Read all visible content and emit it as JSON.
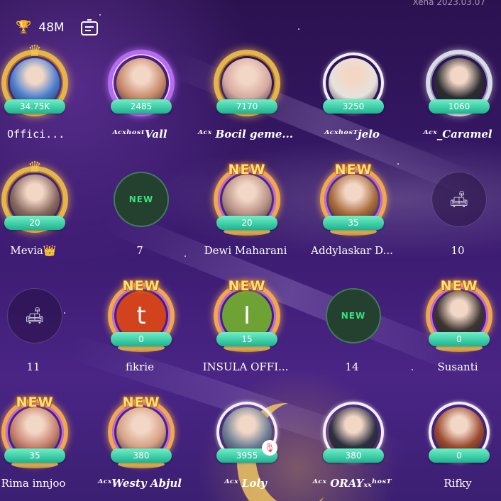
{
  "header": {
    "watermark": "Xena 2023.03.07",
    "trophy_icon": "trophy-icon",
    "trophy_value": "48M",
    "board_icon": "notice-board-icon"
  },
  "seats": [
    {
      "id": 1,
      "name": "Offici...",
      "score": "34.75K",
      "avatar": "#4a7fd0",
      "frame": "gold-crown"
    },
    {
      "id": 2,
      "name": "ᴬᶜˣʰᵒˢᵗVall",
      "score": "2485",
      "avatar": "#c78a6a",
      "frame": "purple"
    },
    {
      "id": 3,
      "name": "ᴬᶜˣ Bocil geme...",
      "score": "7170",
      "avatar": "#d7a9a0",
      "frame": "gold"
    },
    {
      "id": 4,
      "name": "ᴬᶜˣʰᵒˢᵀjelo",
      "score": "3250",
      "avatar": "#e6e2dd",
      "frame": "white"
    },
    {
      "id": 5,
      "name": "ᴬᶜˣ_Caramel",
      "score": "1060",
      "avatar": "#2c2c30",
      "frame": "silver"
    },
    {
      "id": 6,
      "name": "Mevia👑",
      "score": "20",
      "avatar": "#8a6a60",
      "frame": "gold-crown"
    },
    {
      "id": 7,
      "name": "7",
      "score": "",
      "badge": "NEW",
      "frame": "new-empty"
    },
    {
      "id": 8,
      "name": "Dewi Maharani",
      "score": "20",
      "avatar": "#b89186",
      "frame": "new"
    },
    {
      "id": 9,
      "name": "Addylaskar D...",
      "score": "35",
      "avatar": "#a86b3c",
      "frame": "new"
    },
    {
      "id": 10,
      "name": "10",
      "score": "",
      "frame": "empty"
    },
    {
      "id": 11,
      "name": "11",
      "score": "",
      "frame": "empty"
    },
    {
      "id": 12,
      "name": "fikrie",
      "score": "0",
      "letter": "t",
      "avatar": "#d2421c",
      "frame": "new"
    },
    {
      "id": 13,
      "name": "INSULA OFFI...",
      "score": "15",
      "letter": "I",
      "avatar": "#6ea234",
      "frame": "new"
    },
    {
      "id": 14,
      "name": "14",
      "score": "",
      "badge": "NEW",
      "frame": "new-empty"
    },
    {
      "id": 15,
      "name": "Susanti",
      "score": "0",
      "avatar": "#3e3530",
      "frame": "new"
    },
    {
      "id": 16,
      "name": "Rima innjoo",
      "score": "35",
      "avatar": "#c7806e",
      "frame": "new"
    },
    {
      "id": 17,
      "name": "ᴬᶜˣWesty Abjul",
      "score": "380",
      "avatar": "#d6a186",
      "frame": "new"
    },
    {
      "id": 18,
      "name": "ᴬᶜˣ Loly",
      "score": "3955",
      "avatar": "#6c7e96",
      "frame": "white",
      "mic_muted": true
    },
    {
      "id": 19,
      "name": "ᴬᶜˣ ORAYₓₓʰᵒˢᵀ",
      "score": "380",
      "avatar": "#2c3040",
      "frame": "white"
    },
    {
      "id": 20,
      "name": "Rifky",
      "score": "0",
      "avatar": "#9a4a2e",
      "frame": "white"
    }
  ],
  "labels": {
    "new_tag": "NEW",
    "new_seat_text": "NEW"
  },
  "colors": {
    "score_badge": "#2cc49c",
    "gold": "#e5b44c",
    "official_badge": "#b23cf0"
  }
}
